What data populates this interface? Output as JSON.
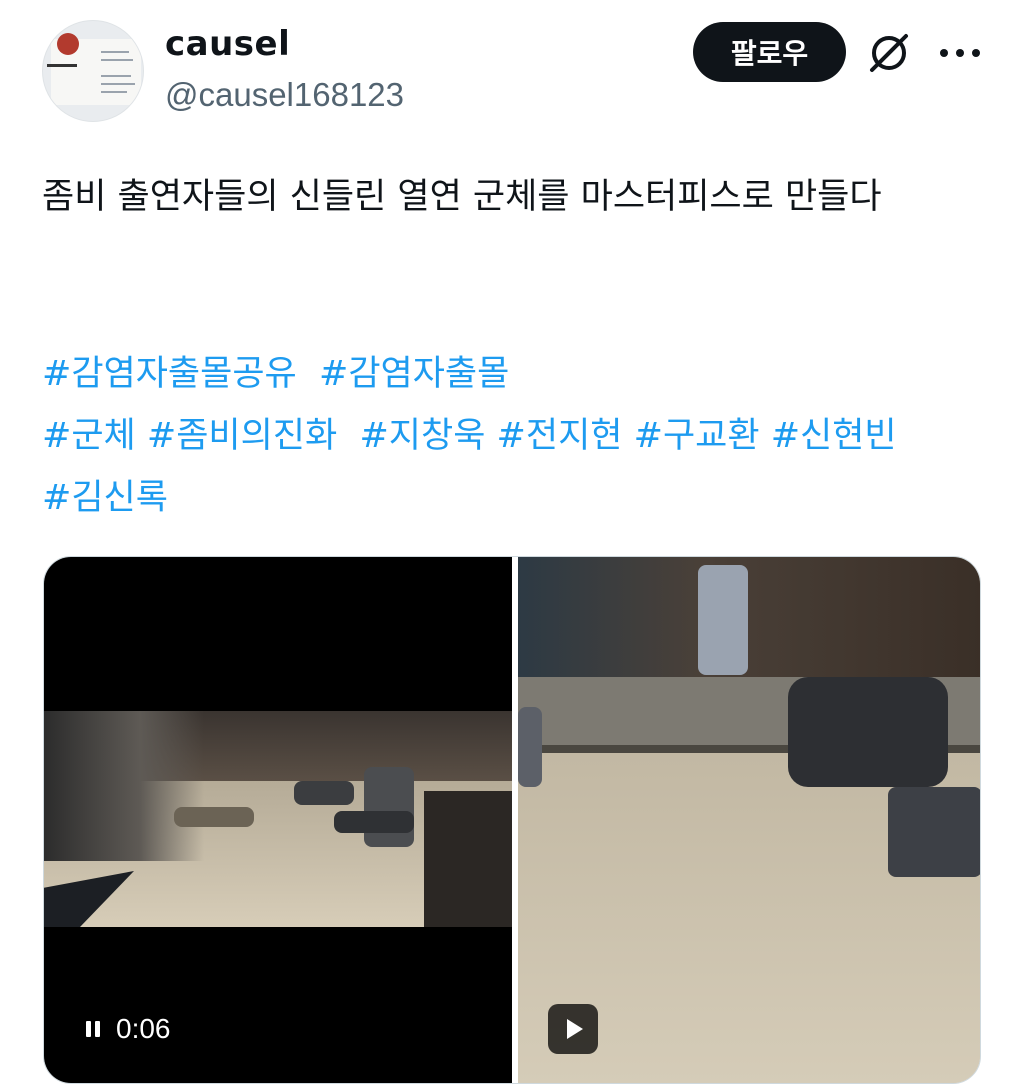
{
  "author": {
    "name": "causel",
    "handle": "@causel168123"
  },
  "actions": {
    "follow_label": "팔로우"
  },
  "tweet": {
    "text": "좀비 출연자들의  신들린 열연 군체를 마스터피스로 만들다",
    "hashtags": [
      "#감염자출몰공유",
      "#감염자출몰",
      "#군체",
      "#좀비의진화",
      "#지창욱",
      "#전지현",
      "#구교환",
      "#신현빈",
      "#김신록"
    ]
  },
  "media": {
    "video1": {
      "timestamp": "0:06"
    }
  },
  "icons": {
    "grok": "grok-icon",
    "more": "more-dots-icon",
    "pause": "pause-icon",
    "play": "play-icon"
  },
  "colors": {
    "link": "#1d9bf0",
    "handle": "#536471",
    "button_bg": "#0f1419"
  }
}
